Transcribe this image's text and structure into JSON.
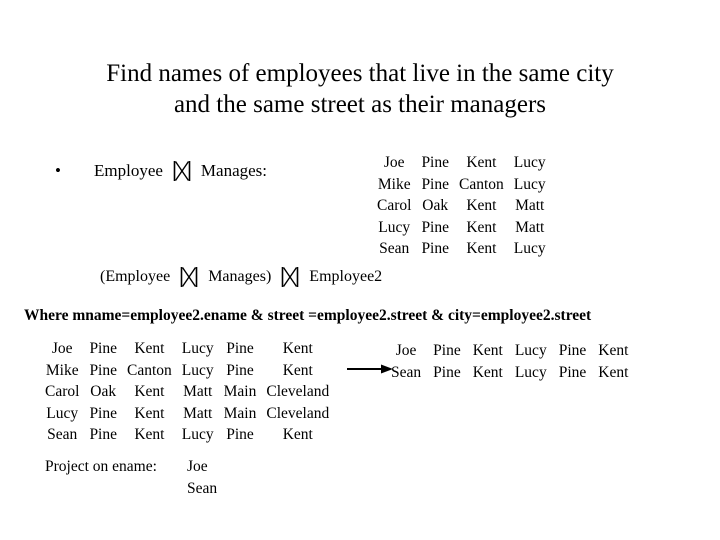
{
  "slide": {
    "title": "Find names of employees that live in the same city\nand the same street as their managers",
    "bullet_marker": "•",
    "bullet_label_left": "Employee",
    "bullet_label_right": "Manages:",
    "join_symbol_name": "natural-join-bowtie",
    "expression": {
      "open_paren": "(Employee",
      "middle": "Manages)",
      "right": "Employee2"
    },
    "where_clause": "Where mname=employee2.ename & street =employee2.street & city=employee2.street",
    "project": {
      "label": "Project on ename:",
      "values": [
        "Joe",
        "Sean"
      ]
    },
    "arrow_name": "right-arrow"
  },
  "tables": {
    "employee_manages": {
      "rows": [
        [
          "Joe",
          "Pine",
          "Kent",
          "Lucy"
        ],
        [
          "Mike",
          "Pine",
          "Canton",
          "Lucy"
        ],
        [
          "Carol",
          "Oak",
          "Kent",
          "Matt"
        ],
        [
          "Lucy",
          "Pine",
          "Kent",
          "Matt"
        ],
        [
          "Sean",
          "Pine",
          "Kent",
          "Lucy"
        ]
      ]
    },
    "joined": {
      "rows": [
        [
          "Joe",
          "Pine",
          "Kent",
          "Lucy",
          "Pine",
          "Kent"
        ],
        [
          "Mike",
          "Pine",
          "Canton",
          "Lucy",
          "Pine",
          "Kent"
        ],
        [
          "Carol",
          "Oak",
          "Kent",
          "Matt",
          "Main",
          "Cleveland"
        ],
        [
          "Lucy",
          "Pine",
          "Kent",
          "Matt",
          "Main",
          "Cleveland"
        ],
        [
          "Sean",
          "Pine",
          "Kent",
          "Lucy",
          "Pine",
          "Kent"
        ]
      ]
    },
    "result": {
      "rows": [
        [
          "Joe",
          "Pine",
          "Kent",
          "Lucy",
          "Pine",
          "Kent"
        ],
        [
          "Sean",
          "Pine",
          "Kent",
          "Lucy",
          "Pine",
          "Kent"
        ]
      ]
    }
  },
  "colors": {
    "background": "#ffffff",
    "text": "#000000"
  }
}
